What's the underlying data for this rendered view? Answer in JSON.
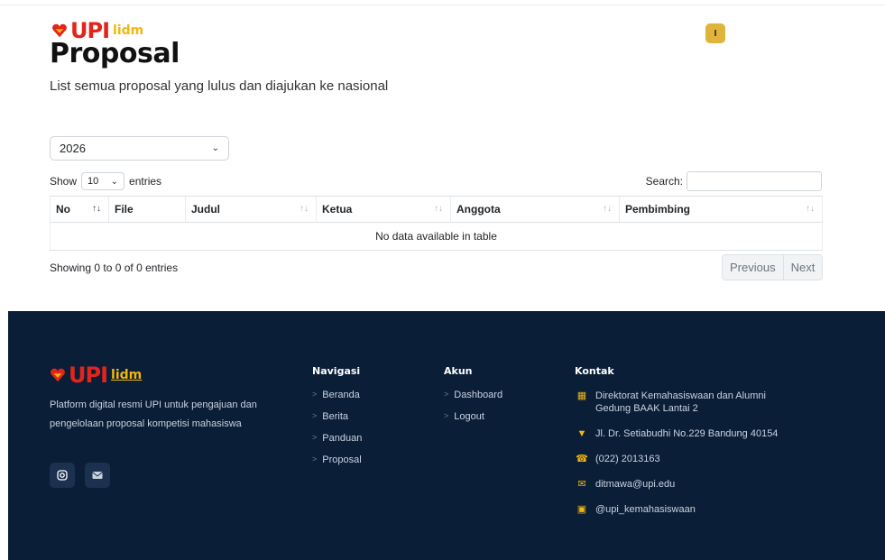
{
  "brand": {
    "upi": "UPI",
    "lidm": "lidm"
  },
  "header": {
    "user_initial": "I"
  },
  "page": {
    "title": "Proposal",
    "subtitle": "List semua proposal yang lulus dan diajukan ke nasional"
  },
  "filter": {
    "year": "2026"
  },
  "table": {
    "show_label": "Show",
    "entries_value": "10",
    "entries_label": "entries",
    "search_label": "Search:",
    "columns": [
      "No",
      "File",
      "Judul",
      "Ketua",
      "Anggota",
      "Pembimbing"
    ],
    "empty_message": "No data available in table",
    "info": "Showing 0 to 0 of 0 entries",
    "prev_label": "Previous",
    "next_label": "Next"
  },
  "footer": {
    "description": "Platform digital resmi UPI untuk pengajuan dan pengelolaan proposal kompetisi mahasiswa",
    "nav_title": "Navigasi",
    "nav_links": [
      "Beranda",
      "Berita",
      "Panduan",
      "Proposal"
    ],
    "akun_title": "Akun",
    "akun_links": [
      "Dashboard",
      "Logout"
    ],
    "kontak_title": "Kontak",
    "contacts": [
      {
        "icon": "building-icon",
        "text": "Direktorat Kemahasiswaan dan Alumni Gedung BAAK Lantai 2"
      },
      {
        "icon": "location-icon",
        "text": "Jl. Dr. Setiabudhi No.229 Bandung 40154"
      },
      {
        "icon": "phone-icon",
        "text": "(022) 2013163"
      },
      {
        "icon": "mail-icon",
        "text": "ditmawa@upi.edu"
      },
      {
        "icon": "instagram-icon",
        "text": "@upi_kemahasiswaan"
      }
    ]
  },
  "colors": {
    "accent": "#f1b70e",
    "brand_red": "#e1251b",
    "footer_bg": "#0b1e37"
  }
}
